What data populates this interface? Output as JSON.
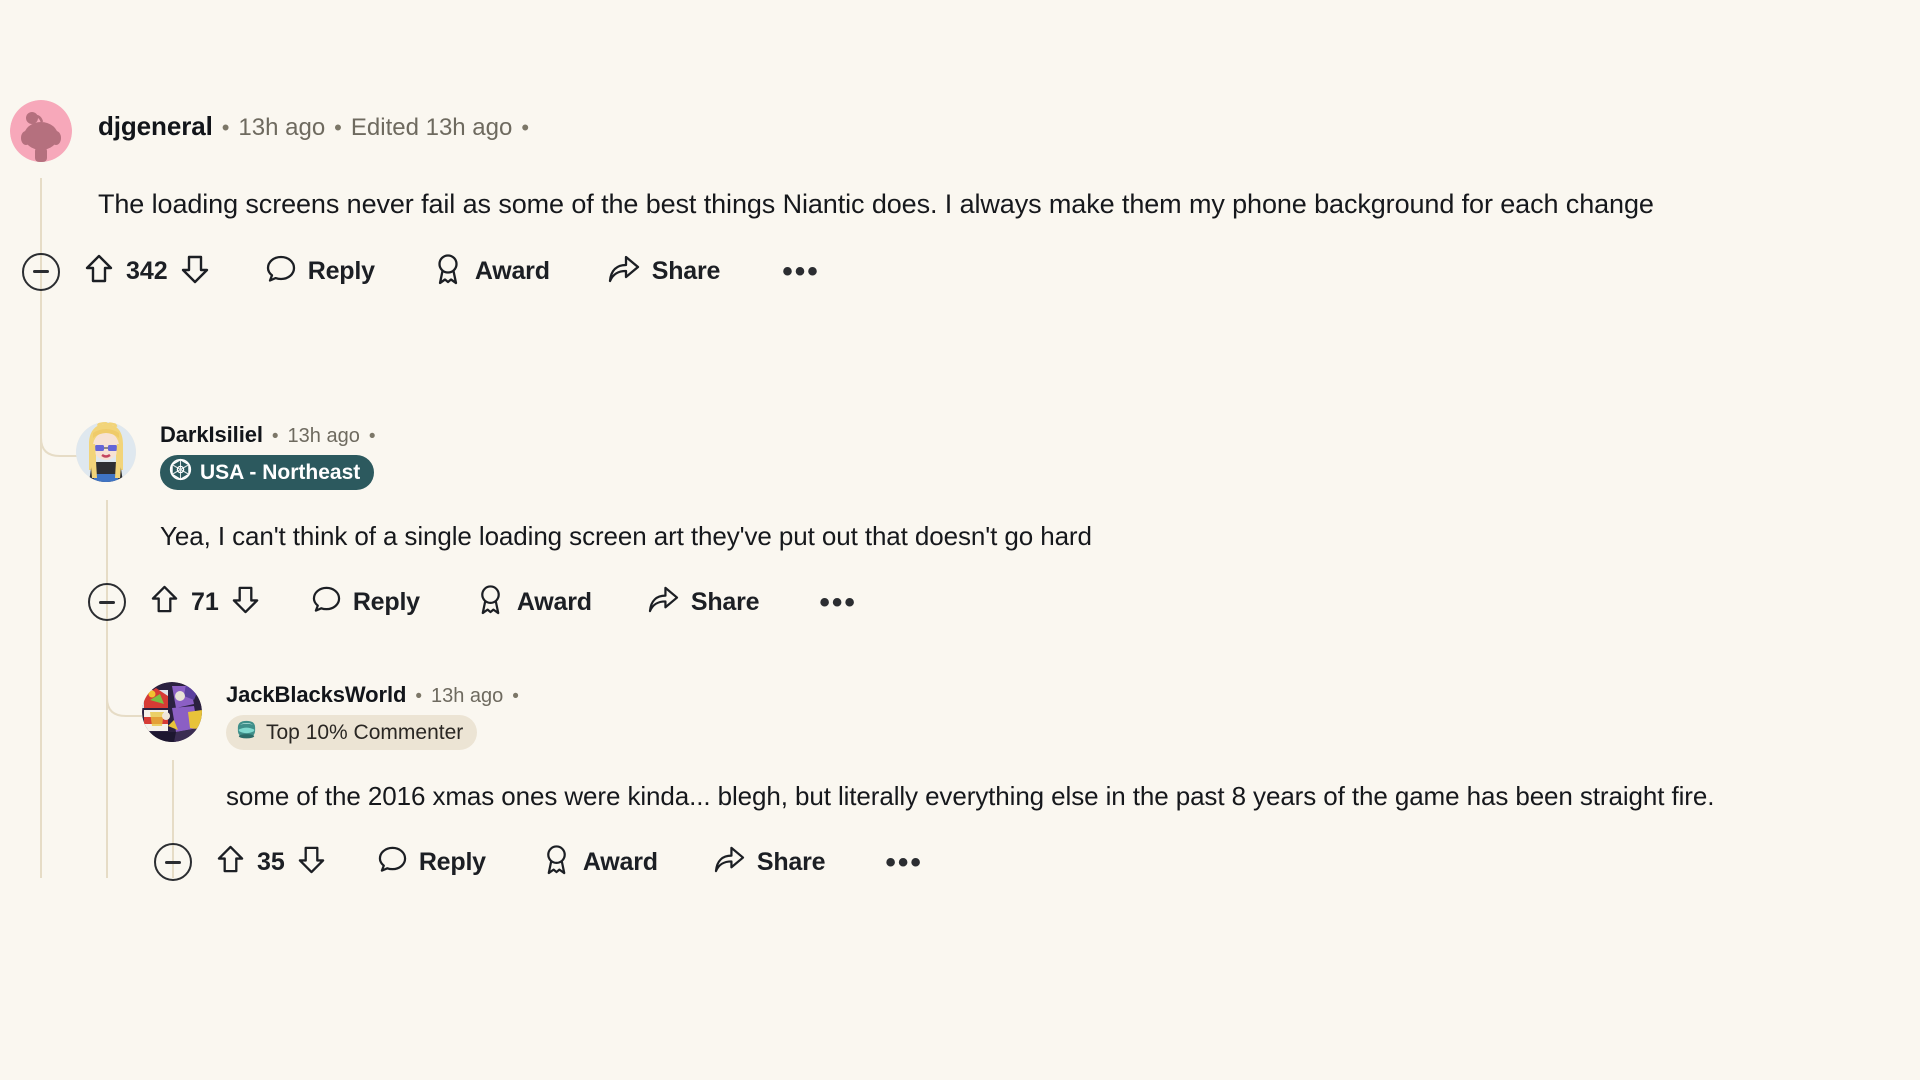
{
  "theme": {
    "page_background": "#faf7f0",
    "text_color": "#16181c",
    "muted_text_color": "#6e6a5f",
    "thread_line_color": "#e6dcc6",
    "flair_teal_background": "#2c595e",
    "flair_cream_background": "#ece4d4"
  },
  "action_labels": {
    "reply": "Reply",
    "award": "Award",
    "share": "Share",
    "overflow": "•••",
    "collapse": "",
    "upvote": "",
    "downvote": ""
  },
  "comments": [
    {
      "id": "c0",
      "depth": 0,
      "author": "djgeneral",
      "separator": "•",
      "timestamp": "13h ago",
      "edited": "Edited 13h ago",
      "trailing_separator": "•",
      "flair": null,
      "body": "The loading screens never fail as some of the best things Niantic does. I always make them my phone background for each change",
      "score": "342",
      "avatar": {
        "name": "reddit-snoo-avatar",
        "background": "#f7a8ba",
        "figure_color": "#b5707e"
      }
    },
    {
      "id": "c1",
      "depth": 1,
      "author": "DarkIsiliel",
      "separator": "•",
      "timestamp": "13h ago",
      "trailing_separator": "•",
      "flair": {
        "text": "USA - Northeast",
        "style": "teal",
        "icon": "geodesic-sphere-icon"
      },
      "body": "Yea, I can't think of a single loading screen art they've put out that doesn't go hard",
      "score": "71",
      "avatar": {
        "name": "blonde-character-avatar",
        "background": "#dfe8ef",
        "hair_color": "#f2d479",
        "skin_color": "#f7e2d4",
        "shirt_color": "#2e2f33"
      }
    },
    {
      "id": "c2",
      "depth": 2,
      "author": "JackBlacksWorld",
      "separator": "•",
      "timestamp": "13h ago",
      "trailing_separator": "•",
      "flair": {
        "text": "Top 10% Commenter",
        "style": "cream",
        "icon": "top-commenter-gem-icon"
      },
      "body": "some of the 2016 xmas ones were kinda... blegh, but literally everything else in the past 8 years of the game has been straight fire.",
      "score": "35",
      "avatar": {
        "name": "colorful-collage-avatar",
        "background": "#2b2140",
        "accent_1": "#8b5fc4",
        "accent_2": "#e8c33a",
        "accent_3": "#d63b35"
      }
    }
  ]
}
